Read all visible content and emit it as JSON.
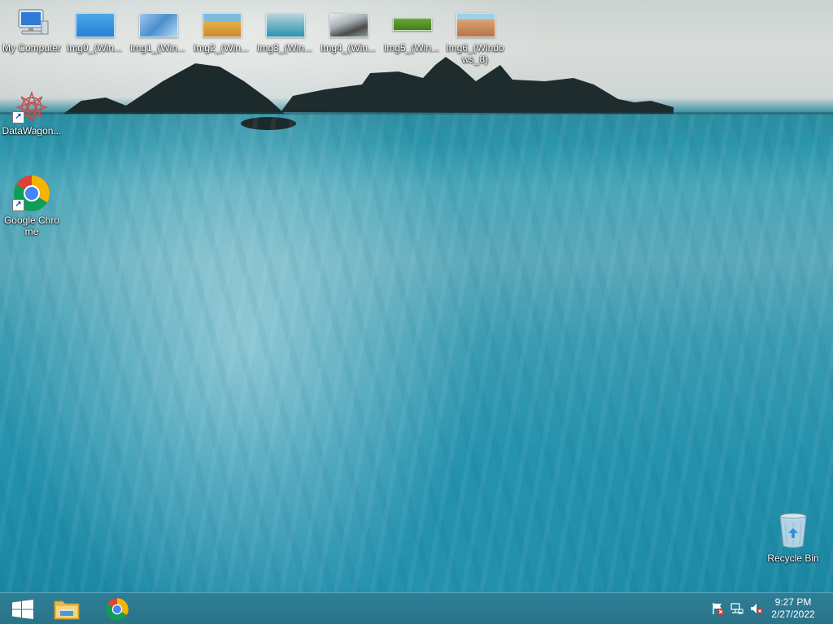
{
  "desktop": {
    "icons": [
      {
        "label": "My Computer",
        "icon": "computer-icon"
      },
      {
        "label": "Img0_(Win...",
        "icon": "image-thumbnail-icon"
      },
      {
        "label": "Img1_(Win...",
        "icon": "image-thumbnail-icon"
      },
      {
        "label": "Img2_(Win...",
        "icon": "image-thumbnail-icon"
      },
      {
        "label": "Img3_(Win...",
        "icon": "image-thumbnail-icon"
      },
      {
        "label": "Img4_(Win...",
        "icon": "image-thumbnail-icon"
      },
      {
        "label": "Img5_(Win...",
        "icon": "image-thumbnail-icon"
      },
      {
        "label": "Img6_(Windows_8)",
        "icon": "image-thumbnail-icon"
      },
      {
        "label": "DataWagon...",
        "icon": "datawagon-icon"
      },
      {
        "label": "Google Chrome",
        "icon": "chrome-icon"
      },
      {
        "label": "Recycle Bin",
        "icon": "recycle-bin-icon"
      }
    ]
  },
  "taskbar": {
    "buttons": [
      {
        "name": "start",
        "icon": "windows-logo-icon"
      },
      {
        "name": "file-explorer",
        "icon": "folder-icon"
      },
      {
        "name": "chrome",
        "icon": "chrome-icon"
      }
    ],
    "tray": [
      {
        "icon": "action-center-flag-icon"
      },
      {
        "icon": "network-icon"
      },
      {
        "icon": "volume-muted-icon"
      }
    ],
    "clock": {
      "time": "9:27 PM",
      "date": "2/27/2022"
    }
  },
  "colors": {
    "taskbar": "#2e7e96",
    "sea": "#2592ad"
  }
}
